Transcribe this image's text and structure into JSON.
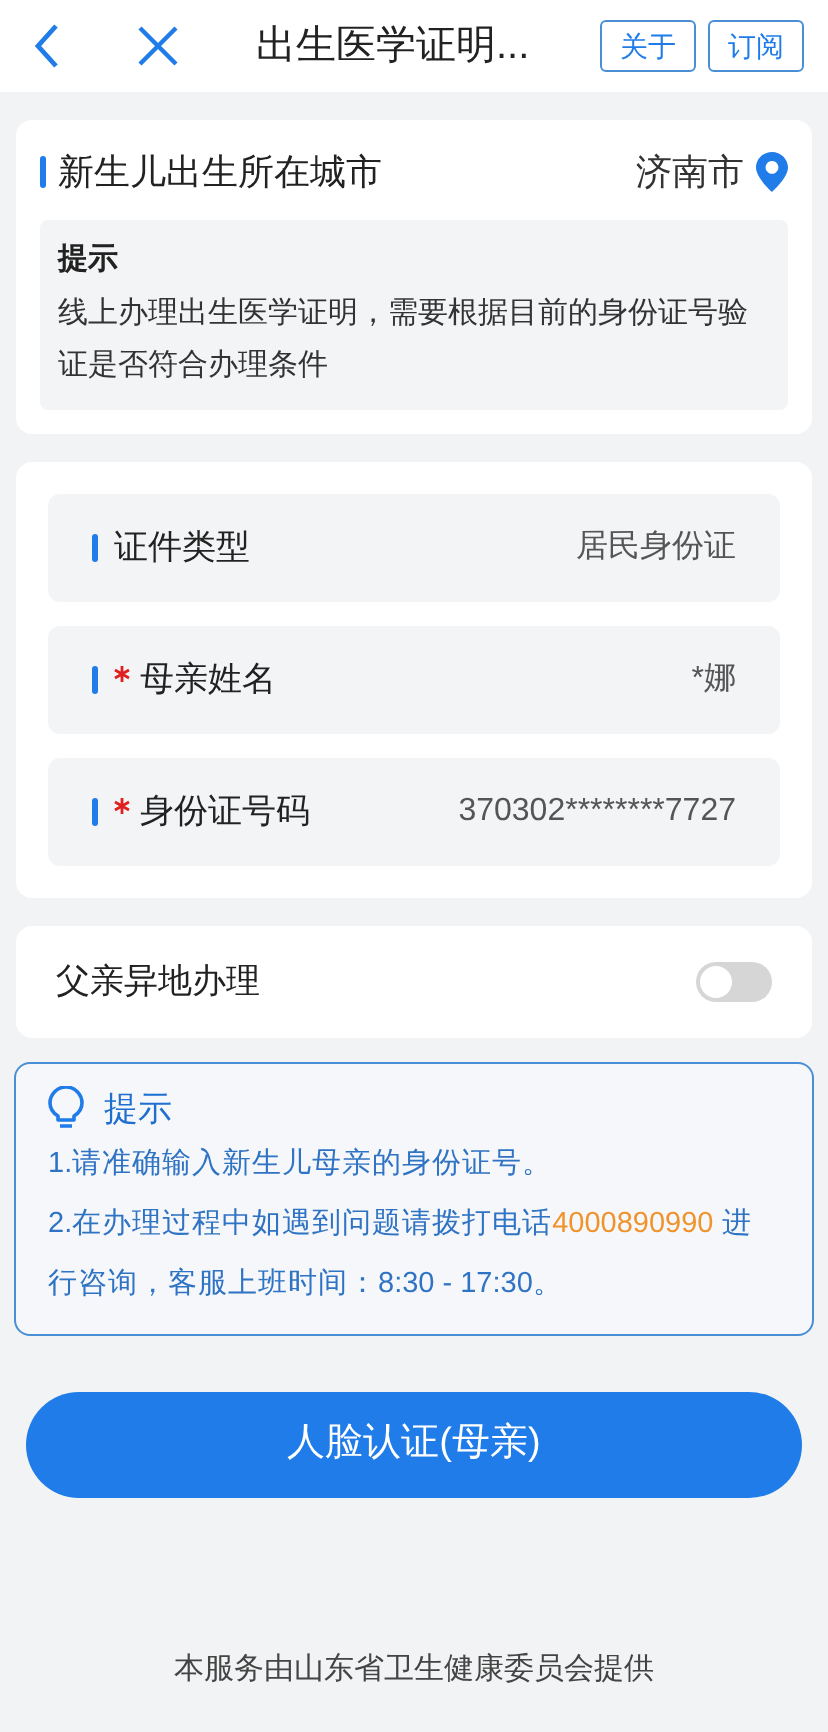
{
  "header": {
    "title": "出生医学证明...",
    "buttons": [
      "关于",
      "订阅"
    ]
  },
  "city": {
    "label": "新生儿出生所在城市",
    "value": "济南市"
  },
  "notice": {
    "title": "提示",
    "text": "线上办理出生医学证明，需要根据目前的身份证号验证是否符合办理条件"
  },
  "fields": [
    {
      "label": "证件类型",
      "required": false,
      "value": "居民身份证"
    },
    {
      "label": "母亲姓名",
      "required": true,
      "value": "*娜"
    },
    {
      "label": "身份证号码",
      "required": true,
      "value": "370302********7727"
    }
  ],
  "father_remote": {
    "label": "父亲异地办理",
    "on": false
  },
  "tips": {
    "title": "提示",
    "items": [
      {
        "text": "1.请准确输入新生儿母亲的身份证号。"
      },
      {
        "text": "2.在办理过程中如遇到问题请拨打电话",
        "phone": "4000890990",
        "after": " 进行咨询，客服上班时间：8:30 - 17:30。"
      }
    ]
  },
  "submit_button": "人脸认证(母亲)",
  "footer": "本服务由山东省卫生健康委员会提供"
}
